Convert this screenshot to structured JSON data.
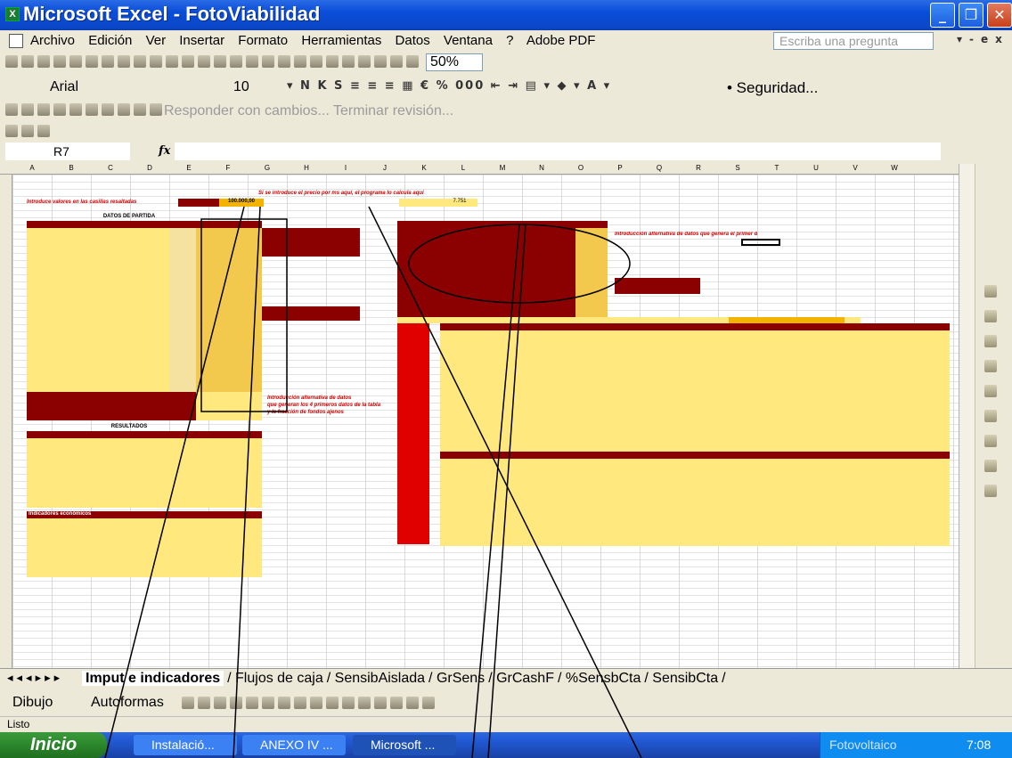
{
  "window": {
    "title": "Microsoft Excel - FotoViabilidad"
  },
  "menu": {
    "items": [
      "Archivo",
      "Edición",
      "Ver",
      "Insertar",
      "Formato",
      "Herramientas",
      "Datos",
      "Ventana",
      "?",
      "Adobe PDF"
    ],
    "ask_placeholder": "Escriba una pregunta"
  },
  "toolbar": {
    "zoom": "50%",
    "font_name": "Arial",
    "font_size": "10",
    "security_label": "• Seguridad...",
    "review_label": "Responder con cambios... Terminar revisión..."
  },
  "formula_bar": {
    "name_box": "R7",
    "fx": "fx"
  },
  "sheet": {
    "note_top": "Si se introduce el precio por ms aquí, el programa lo calcula aquí",
    "input_prompt": "Introduce valores en las casillas resaltadas",
    "section_header": "DATOS DE PARTIDA",
    "results_header": "RESULTADOS",
    "indicators_header": "Indicadores económicos",
    "input_prompt_2": "Introducción alternativa de datos",
    "input_prompt_2b": "que generan los 4 primeros datos de la tabla",
    "input_prompt_2c": "y la fracción de fondos ajenos",
    "cost_note": "Introducción alternativa de datos que genera el primer dato de la tabla",
    "value_1": "100.000,00",
    "value_2": "7.751",
    "column_letters": [
      "A",
      "B",
      "C",
      "D",
      "E",
      "F",
      "G",
      "H",
      "I",
      "J",
      "K",
      "L",
      "M",
      "N",
      "O",
      "P",
      "Q",
      "R",
      "S",
      "T",
      "U",
      "V",
      "W"
    ]
  },
  "tabs": {
    "items": [
      "Imput e indicadores",
      "Flujos de caja",
      "SensibAislada",
      "GrSens",
      "GrCashF",
      "%SensbCta",
      "SensibCta"
    ],
    "active": "Imput e indicadores"
  },
  "drawing": {
    "dibujo": "Dibujo",
    "autoformas": "Autoformas"
  },
  "status": {
    "text": "Listo"
  },
  "taskbar": {
    "start": "Inicio",
    "tasks": [
      "Instalació...",
      "ANEXO IV ...",
      "Microsoft ..."
    ],
    "tray_label": "Fotovoltaico",
    "clock": "7:08"
  },
  "colors": {
    "xp_blue": "#0A4DD8",
    "sheet_red": "#8B0000",
    "sheet_yellow": "#FFE97F",
    "sheet_orange": "#F2B400"
  }
}
